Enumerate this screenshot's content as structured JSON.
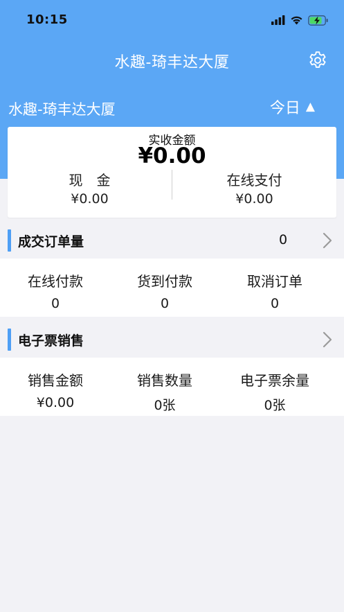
{
  "status_bar": {
    "time": "10:15"
  },
  "nav": {
    "title": "水趣-琦丰达大厦"
  },
  "sub_bar": {
    "store_name": "水趣-琦丰达大厦",
    "date_filter": "今日",
    "date_arrow": "▲"
  },
  "revenue": {
    "label": "实收金额",
    "amount": "¥0.00",
    "cash_label": "现　金",
    "cash_value": "¥0.00",
    "online_label": "在线支付",
    "online_value": "¥0.00"
  },
  "orders": {
    "title": "成交订单量",
    "count": "0",
    "stats": [
      {
        "label": "在线付款",
        "value": "0"
      },
      {
        "label": "货到付款",
        "value": "0"
      },
      {
        "label": "取消订单",
        "value": "0"
      }
    ]
  },
  "eticket": {
    "title": "电子票销售",
    "stats": [
      {
        "label": "销售金额",
        "value": "¥0.00"
      },
      {
        "label": "销售数量",
        "value": "0张"
      },
      {
        "label": "电子票余量",
        "value": "0张"
      }
    ]
  },
  "colors": {
    "header_blue": "#5ba7f5",
    "accent_bar": "#4e9ff5",
    "background": "#f2f2f6"
  },
  "icons": [
    "signal-icon",
    "wifi-icon",
    "battery-charging-icon",
    "gear-icon",
    "triangle-up-icon",
    "chevron-right-icon"
  ]
}
